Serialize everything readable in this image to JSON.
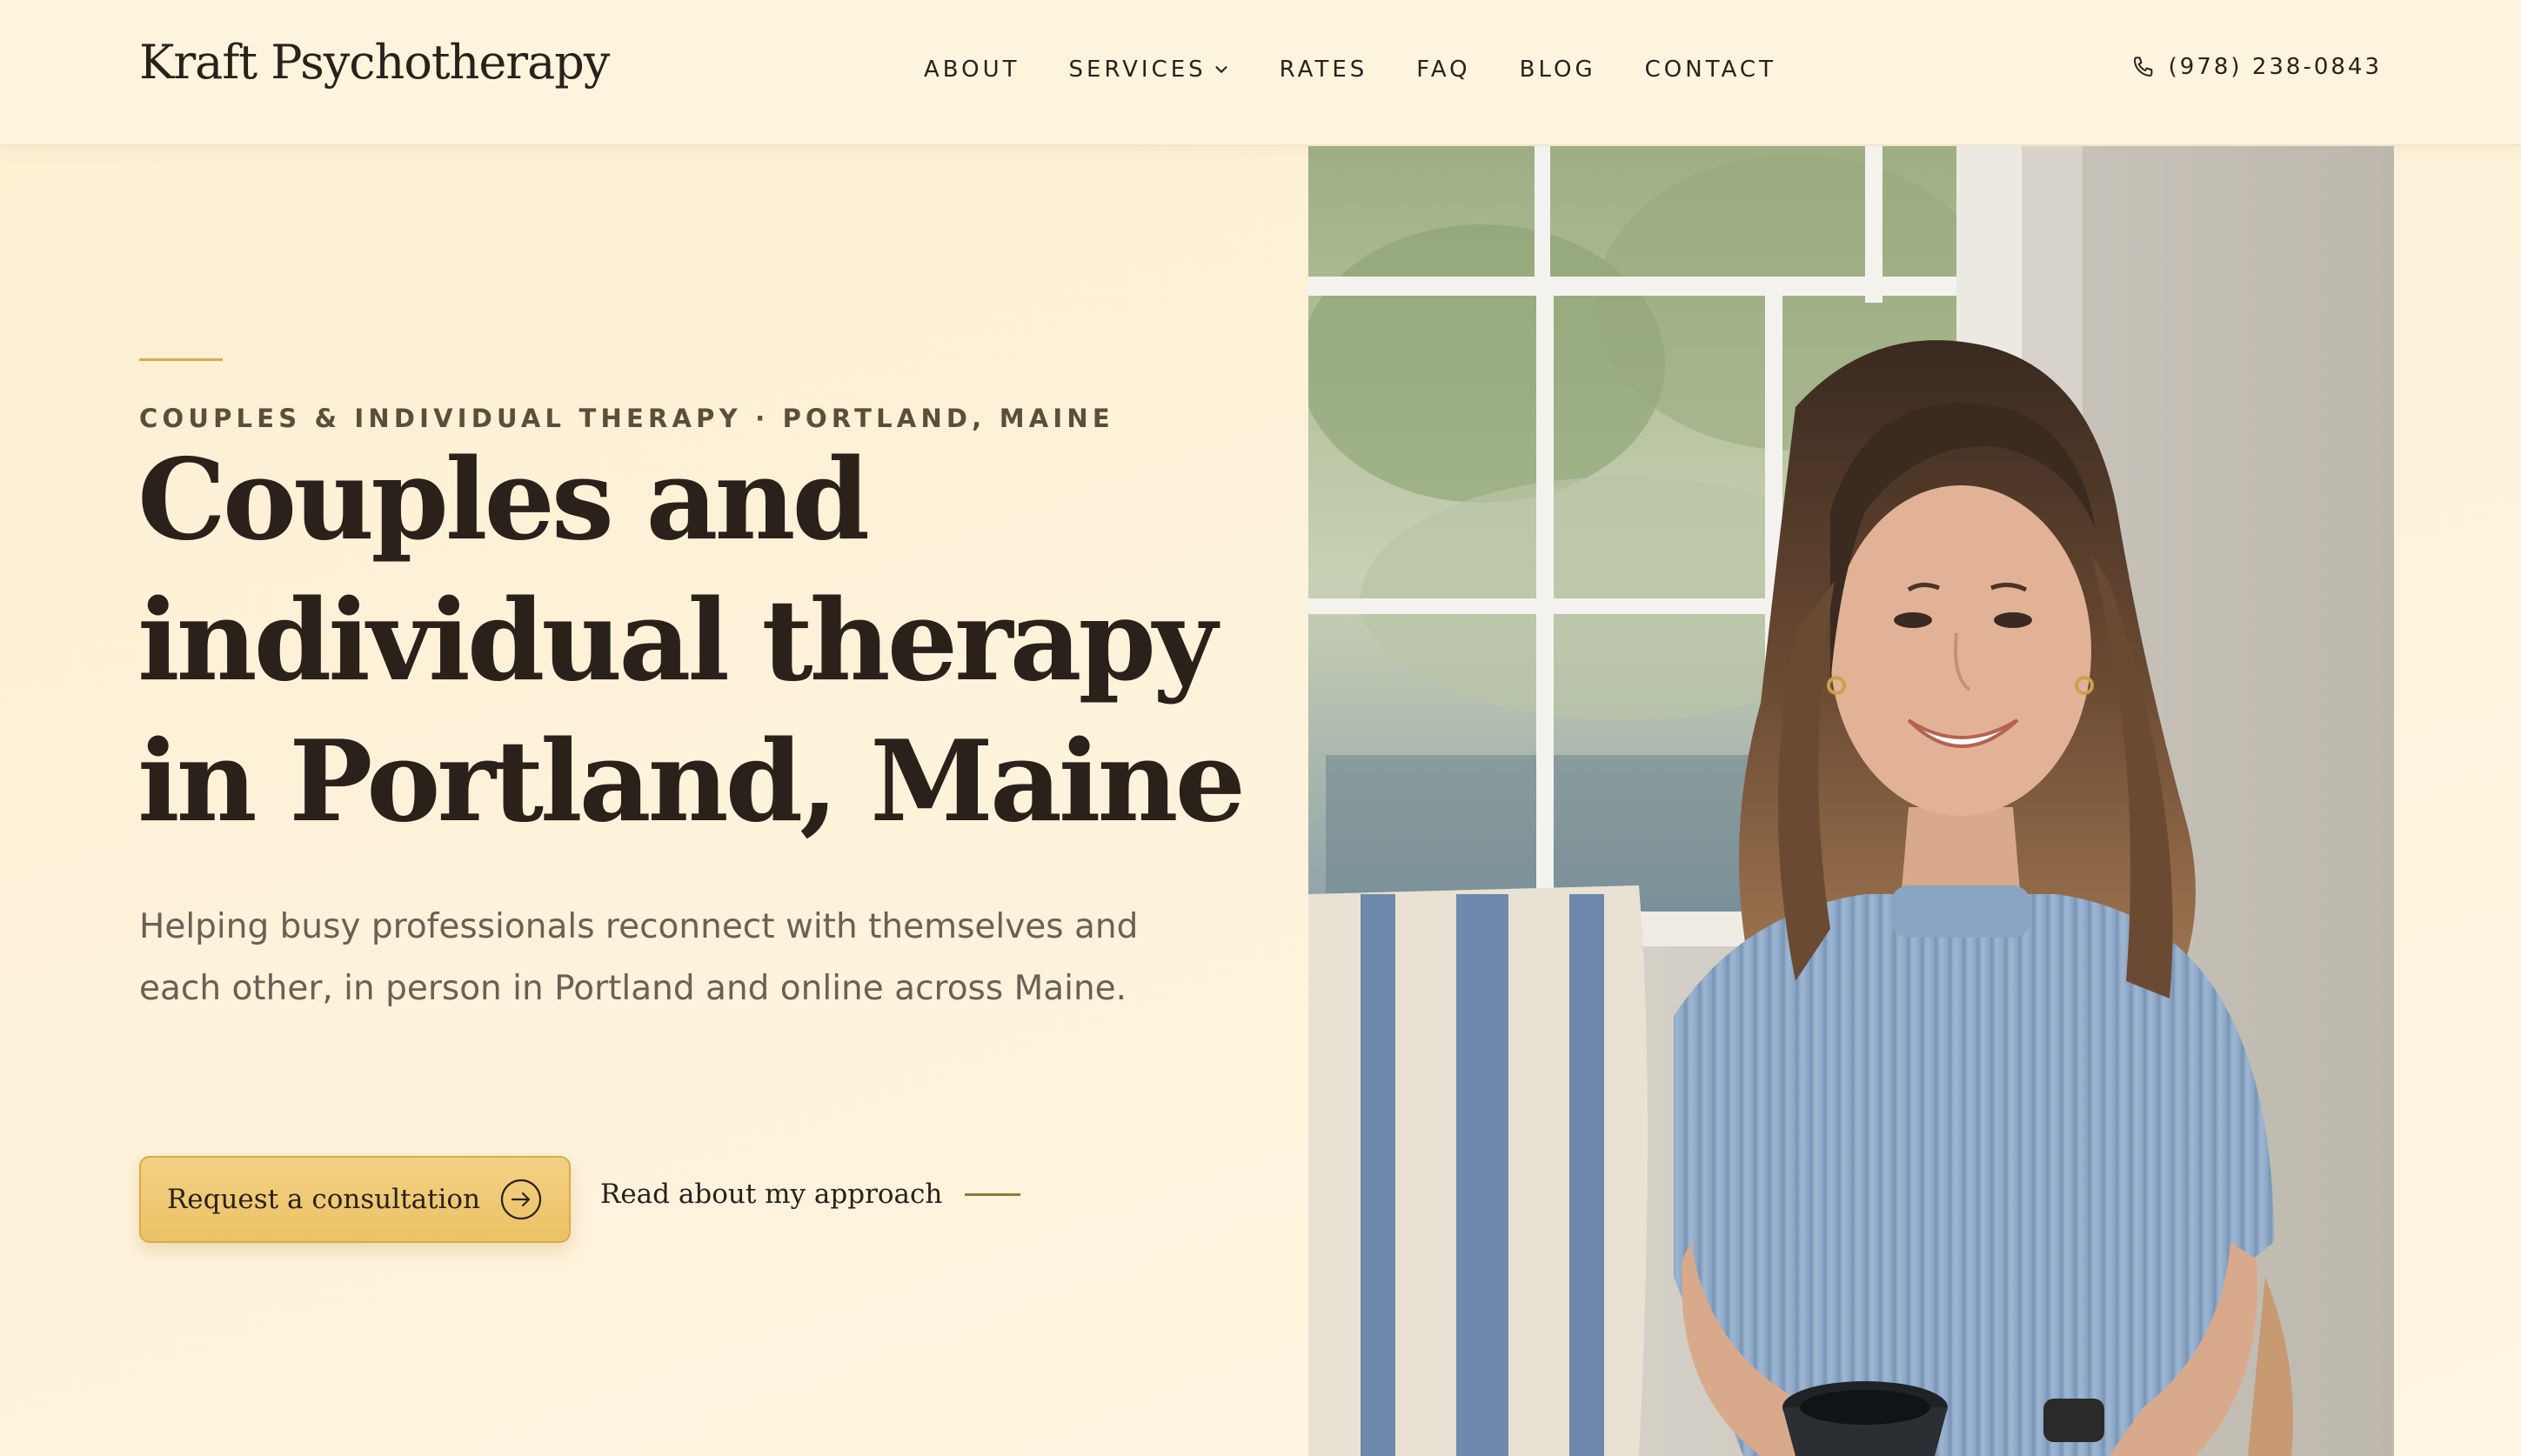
{
  "header": {
    "logo": "Kraft Psychotherapy",
    "nav": [
      {
        "label": "ABOUT"
      },
      {
        "label": "SERVICES",
        "dropdown": true
      },
      {
        "label": "RATES"
      },
      {
        "label": "FAQ"
      },
      {
        "label": "BLOG"
      },
      {
        "label": "CONTACT"
      }
    ],
    "phone": "(978) 238-0843"
  },
  "hero": {
    "eyebrow": "COUPLES & INDIVIDUAL THERAPY · PORTLAND, MAINE",
    "headline": "Couples and individual therapy in Portland, Maine",
    "subtext": "Helping busy professionals reconnect with themselves and each other, in person in Portland and online across Maine.",
    "primary_cta": "Request a consultation",
    "secondary_cta": "Read about my approach"
  },
  "colors": {
    "background": "#fdf3dc",
    "accent": "#ebc264",
    "text": "#2a211b",
    "muted_text": "#6a6054"
  },
  "icons": [
    "phone-icon",
    "chevron-down-icon",
    "arrow-right-circle-icon"
  ]
}
